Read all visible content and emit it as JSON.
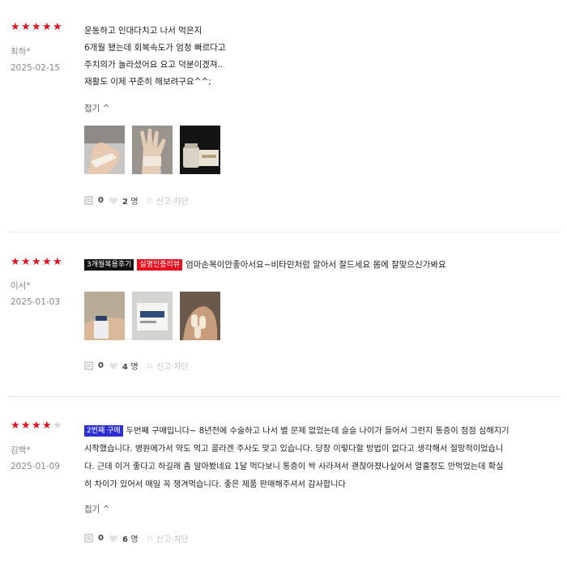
{
  "reviews": [
    {
      "rating": 5,
      "author": "최하*",
      "date": "2025-02-15",
      "lines": [
        "운동하고 인대다치고 나서 먹은지",
        "6개월 됐는데 회복속도가 엄청 빠르다고",
        "주치의가 놀라셨어요 요고 덕분이겠져..",
        "재활도 이제 꾸준히 해보려구요^^;"
      ],
      "fold_label": "접기 ^",
      "photos": [
        "hand-photo-1",
        "hand-photo-2",
        "product-photo"
      ],
      "comment_count": "0",
      "like_count": "2",
      "like_unit": "명",
      "report_label": "신고·차단"
    },
    {
      "rating": 5,
      "author": "이서*",
      "date": "2025-01-03",
      "badges": [
        "3개월복용후기",
        "실명인증리뷰"
      ],
      "text": "엄마손목이안좋아서요~비타민처럼 알아서 잘드세요 몸에 잘맞으신가봐요",
      "photos": [
        "bottle-photo",
        "box-photo",
        "capsule-photo"
      ],
      "comment_count": "0",
      "like_count": "4",
      "like_unit": "명",
      "report_label": "신고·차단"
    },
    {
      "rating": 4,
      "author": "김백*",
      "date": "2025-01-09",
      "badges": [
        "2번째 구매"
      ],
      "lines": [
        "두번째 구매입니다~ 8년전에 수술하고 나서 별 문제 없었는데 슬슬 나이가 들어서 그런지 통증이 점점 심해지기",
        "시작했습니다. 병원에가서 약도 먹고 콜라겐 주사도 맞고 있습니다. 당장 이렇다할 방법이 없다고 생각해서 절망적이었습니",
        "다. 근데 이거 좋다고 하길래 좀 알아봤네요 1달 먹다보니 통증이 싹 사라져서 괜찮아졌나싶어서 열흘정도 안먹었는데 확실",
        "히 차이가 있어서 매일 꼭 챙겨먹습니다. 좋은 제품 판매해주셔서 감사합니다"
      ],
      "fold_label": "접기 ^",
      "comment_count": "0",
      "like_count": "6",
      "like_unit": "명",
      "report_label": "신고·차단"
    }
  ],
  "colors": {
    "star_on": "#e8101e",
    "star_off": "#d8d8d8",
    "badge_black": "#111111",
    "badge_red": "#e8101e",
    "badge_blue": "#2d2fd3"
  }
}
